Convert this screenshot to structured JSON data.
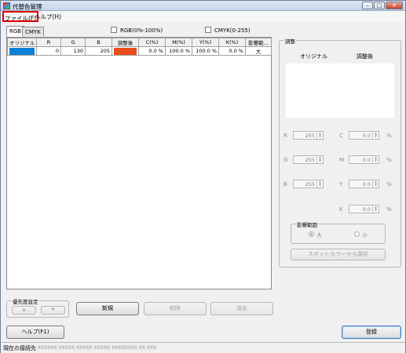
{
  "window": {
    "title": "代替色管理",
    "buttons": {
      "minimize": "–",
      "maximize": "□",
      "close": "✕"
    }
  },
  "menu": {
    "file": "ファイル(F)",
    "help": "ヘルプ(H)"
  },
  "tabs": [
    {
      "label": "RGB",
      "active": true
    },
    {
      "label": "CMYK",
      "active": false
    }
  ],
  "options": {
    "rgb_percent": "RGB(0%-100%)",
    "cmyk_range": "CMYK(0-255)"
  },
  "table": {
    "headers": [
      "オリジナル",
      "R",
      "G",
      "B",
      "調整後",
      "C(%)",
      "M(%)",
      "Y(%)",
      "K(%)",
      "影響範..."
    ],
    "rows": [
      {
        "original_color": "#0c7fd8",
        "r": "0",
        "g": "130",
        "b": "205",
        "adjusted_color": "#e84e1b",
        "c": "0.0 %",
        "m": "100.0 %",
        "y": "100.0 %",
        "k": "0.0 %",
        "range": "大"
      }
    ]
  },
  "priority": {
    "title": "優先度設定",
    "up": "▲",
    "down": "▼"
  },
  "buttons": {
    "new": "新規",
    "delete": "削除",
    "clear": "消去",
    "help": "ヘルプ(F1)",
    "register": "登録"
  },
  "adjust": {
    "title": "調整",
    "original_label": "オリジナル",
    "adjusted_label": "調整後",
    "r_label": "R",
    "r_value": "255",
    "g_label": "G",
    "g_value": "255",
    "b_label": "B",
    "b_value": "255",
    "c_label": "C",
    "c_value": "0.0",
    "m_label": "M",
    "m_value": "0.0",
    "y_label": "Y",
    "y_value": "0.0",
    "k_label": "K",
    "k_value": "0.0",
    "percent": "%",
    "range_title": "影響範囲",
    "range_large": "大",
    "range_small": "小",
    "eyedropper": "スポットカラーから選択"
  },
  "status": {
    "label": "現在の接続先",
    "value": "XXXXXX XXXXX XXXXX XXXXX XXXXXXXX XX XXX"
  }
}
